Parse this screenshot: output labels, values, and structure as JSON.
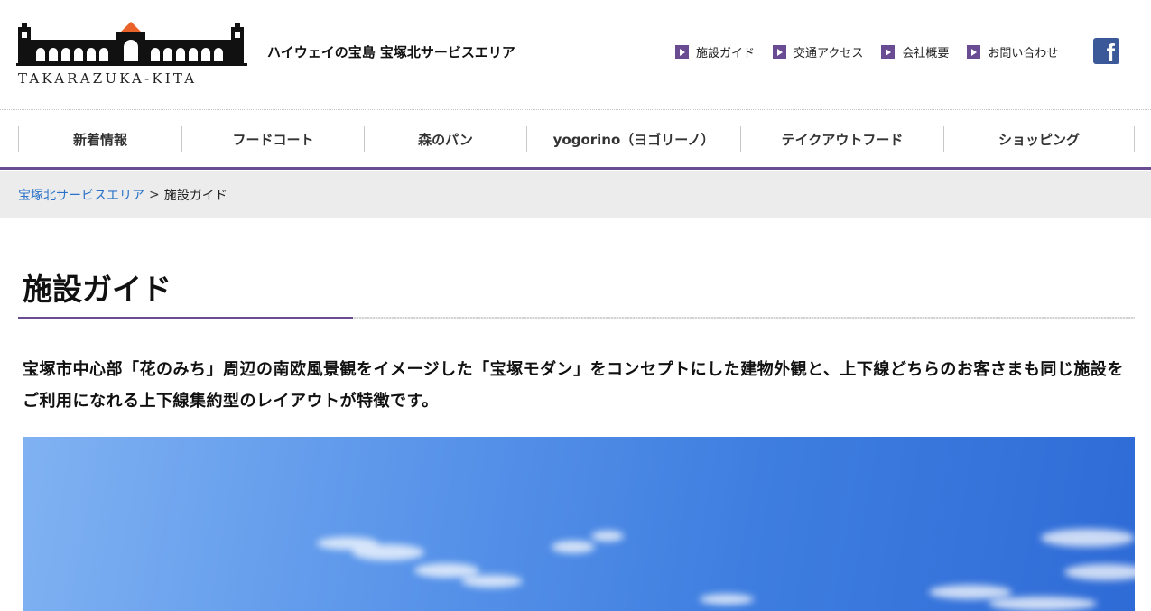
{
  "header": {
    "logo_text": "TAKARAZUKA-KITA",
    "site_title": "ハイウェイの宝島 宝塚北サービスエリア",
    "top_links": [
      "施設ガイド",
      "交通アクセス",
      "会社概要",
      "お問い合わせ"
    ],
    "facebook_icon": "f"
  },
  "nav": {
    "items": [
      "新着情報",
      "フードコート",
      "森のパン",
      "yogorino（ヨゴリーノ）",
      "テイクアウトフード",
      "ショッピング"
    ]
  },
  "breadcrumb": {
    "home": "宝塚北サービスエリア",
    "separator": ">",
    "current": "施設ガイド"
  },
  "main": {
    "title": "施設ガイド",
    "intro": "宝塚市中心部「花のみち」周辺の南欧風景観をイメージした「宝塚モダン」をコンセプトにした建物外観と、上下線どちらのお客さまも同じ施設をご利用になれる上下線集約型のレイアウトが特徴です。"
  },
  "colors": {
    "accent": "#6a4c93",
    "link": "#2a72c9",
    "facebook": "#3b5998",
    "logo_roof": "#e8622a"
  }
}
